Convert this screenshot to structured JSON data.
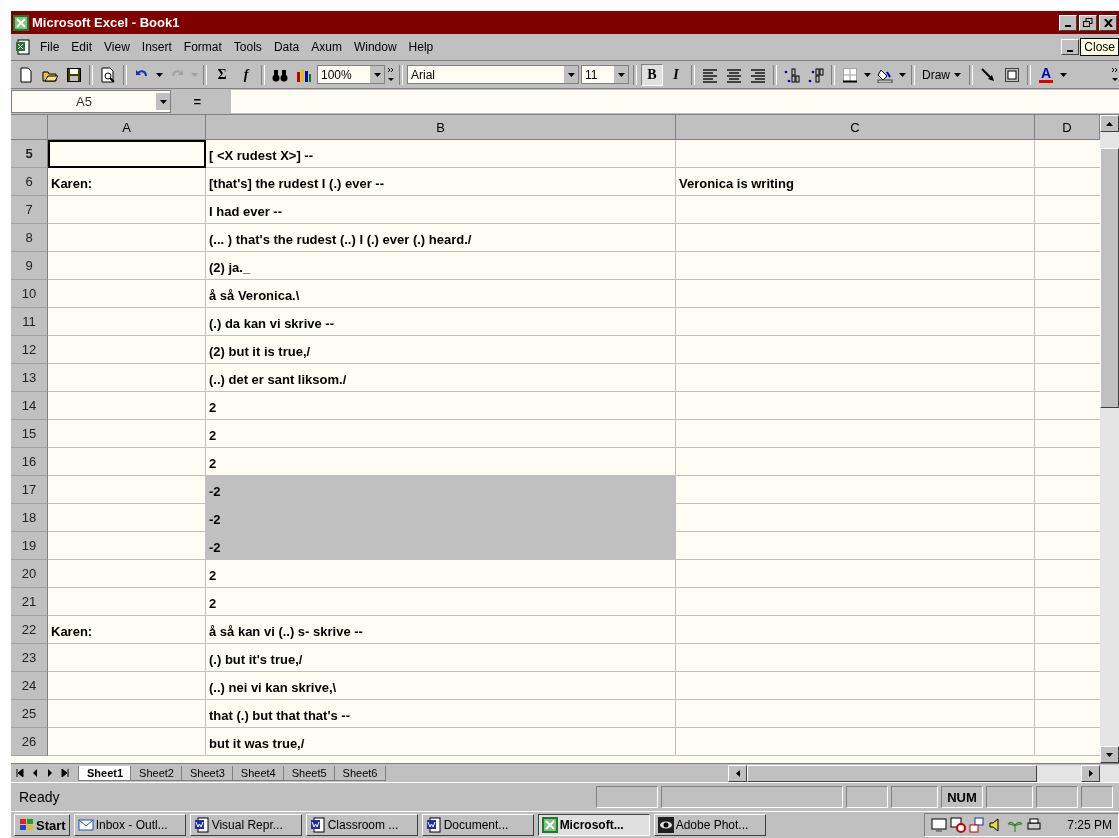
{
  "window": {
    "title": "Microsoft Excel - Book1",
    "tooltip": "Close"
  },
  "menu": [
    "File",
    "Edit",
    "View",
    "Insert",
    "Format",
    "Tools",
    "Data",
    "Axum",
    "Window",
    "Help"
  ],
  "toolbar": {
    "sum": "Σ",
    "function": "f",
    "zoom": "100%",
    "font": "Arial",
    "size": "11",
    "bold": {
      "label": "B",
      "on": true
    },
    "italic": {
      "label": "I",
      "on": false
    },
    "draw": "Draw",
    "font_color": "A"
  },
  "name_box": "A5",
  "formula_button": "=",
  "columns": [
    "A",
    "B",
    "C",
    "D"
  ],
  "rows": [
    {
      "header": "5",
      "selected": true,
      "cells": [
        {
          "active": true,
          "selected": false
        },
        {
          "text": "[ <X rudest X>] --",
          "active": false,
          "selected": false
        },
        {
          "active": false,
          "selected": false
        }
      ]
    },
    {
      "header": "6",
      "selected": false,
      "cells": [
        {
          "text": "Karen:",
          "active": false,
          "selected": false
        },
        {
          "text": "[that's] the rudest I (.) ever --",
          "active": false,
          "selected": false
        },
        {
          "text": "Veronica is writing",
          "active": false,
          "selected": false
        }
      ]
    },
    {
      "header": "7",
      "selected": false,
      "cells": [
        {
          "active": false,
          "selected": false
        },
        {
          "text": "I had ever --",
          "active": false,
          "selected": false
        },
        {
          "active": false,
          "selected": false
        }
      ]
    },
    {
      "header": "8",
      "selected": false,
      "cells": [
        {
          "active": false,
          "selected": false
        },
        {
          "text": "(... ) that's the rudest (..) I (.) ever (.) heard./",
          "active": false,
          "selected": false
        },
        {
          "active": false,
          "selected": false
        }
      ]
    },
    {
      "header": "9",
      "selected": false,
      "cells": [
        {
          "active": false,
          "selected": false
        },
        {
          "text": "(2) ja._",
          "active": false,
          "selected": false
        },
        {
          "active": false,
          "selected": false
        }
      ]
    },
    {
      "header": "10",
      "selected": false,
      "cells": [
        {
          "active": false,
          "selected": false
        },
        {
          "text": "å  så Veronica.\\",
          "active": false,
          "selected": false
        },
        {
          "active": false,
          "selected": false
        }
      ]
    },
    {
      "header": "11",
      "selected": false,
      "cells": [
        {
          "active": false,
          "selected": false
        },
        {
          "text": "(.) da kan vi skrive --",
          "active": false,
          "selected": false
        },
        {
          "active": false,
          "selected": false
        }
      ]
    },
    {
      "header": "12",
      "selected": false,
      "cells": [
        {
          "active": false,
          "selected": false
        },
        {
          "text": "(2) but it is true,/",
          "active": false,
          "selected": false
        },
        {
          "active": false,
          "selected": false
        }
      ]
    },
    {
      "header": "13",
      "selected": false,
      "cells": [
        {
          "active": false,
          "selected": false
        },
        {
          "text": "(..) det er sant liksom./",
          "active": false,
          "selected": false
        },
        {
          "active": false,
          "selected": false
        }
      ]
    },
    {
      "header": "14",
      "selected": false,
      "cells": [
        {
          "active": false,
          "selected": false
        },
        {
          "text": "2",
          "active": false,
          "selected": false
        },
        {
          "active": false,
          "selected": false
        }
      ]
    },
    {
      "header": "15",
      "selected": false,
      "cells": [
        {
          "active": false,
          "selected": false
        },
        {
          "text": "2",
          "active": false,
          "selected": false
        },
        {
          "active": false,
          "selected": false
        }
      ]
    },
    {
      "header": "16",
      "selected": false,
      "cells": [
        {
          "active": false,
          "selected": false
        },
        {
          "text": "2",
          "active": false,
          "selected": false
        },
        {
          "active": false,
          "selected": false
        }
      ]
    },
    {
      "header": "17",
      "selected": false,
      "cells": [
        {
          "active": false,
          "selected": false
        },
        {
          "text": "-2",
          "active": false,
          "selected": true
        },
        {
          "active": false,
          "selected": false
        }
      ]
    },
    {
      "header": "18",
      "selected": false,
      "cells": [
        {
          "active": false,
          "selected": false
        },
        {
          "text": "-2",
          "active": false,
          "selected": true
        },
        {
          "active": false,
          "selected": false
        }
      ]
    },
    {
      "header": "19",
      "selected": false,
      "cells": [
        {
          "active": false,
          "selected": false
        },
        {
          "text": "-2",
          "active": false,
          "selected": true
        },
        {
          "active": false,
          "selected": false
        }
      ]
    },
    {
      "header": "20",
      "selected": false,
      "cells": [
        {
          "active": false,
          "selected": false
        },
        {
          "text": "2",
          "active": false,
          "selected": false
        },
        {
          "active": false,
          "selected": false
        }
      ]
    },
    {
      "header": "21",
      "selected": false,
      "cells": [
        {
          "active": false,
          "selected": false
        },
        {
          "text": "2",
          "active": false,
          "selected": false
        },
        {
          "active": false,
          "selected": false
        }
      ]
    },
    {
      "header": "22",
      "selected": false,
      "cells": [
        {
          "text": "Karen:",
          "active": false,
          "selected": false
        },
        {
          "text": "å så kan vi (..) s- skrive --",
          "active": false,
          "selected": false
        },
        {
          "active": false,
          "selected": false
        }
      ]
    },
    {
      "header": "23",
      "selected": false,
      "cells": [
        {
          "active": false,
          "selected": false
        },
        {
          "text": "(.) but it's true,/",
          "active": false,
          "selected": false
        },
        {
          "active": false,
          "selected": false
        }
      ]
    },
    {
      "header": "24",
      "selected": false,
      "cells": [
        {
          "active": false,
          "selected": false
        },
        {
          "text": "(..) nei vi kan skrive,\\",
          "active": false,
          "selected": false
        },
        {
          "active": false,
          "selected": false
        }
      ]
    },
    {
      "header": "25",
      "selected": false,
      "cells": [
        {
          "active": false,
          "selected": false
        },
        {
          "text": "that (.) but that that's --",
          "active": false,
          "selected": false
        },
        {
          "active": false,
          "selected": false
        }
      ]
    },
    {
      "header": "26",
      "selected": false,
      "cells": [
        {
          "active": false,
          "selected": false
        },
        {
          "text": "but it was true,/",
          "active": false,
          "selected": false
        },
        {
          "active": false,
          "selected": false
        }
      ]
    }
  ],
  "sheet_tabs": [
    {
      "label": "Sheet1",
      "selected": true
    },
    {
      "label": "Sheet2",
      "selected": false
    },
    {
      "label": "Sheet3",
      "selected": false
    },
    {
      "label": "Sheet4",
      "selected": false
    },
    {
      "label": "Sheet5",
      "selected": false
    },
    {
      "label": "Sheet6",
      "selected": false
    }
  ],
  "status_bar": {
    "text": "Ready",
    "indicator": "NUM"
  },
  "taskbar": {
    "start": "Start",
    "tasks": [
      {
        "label": "Inbox - Outl...",
        "kind": "mail",
        "selected": false
      },
      {
        "label": "Visual Repr...",
        "kind": "doc",
        "selected": false
      },
      {
        "label": "Classroom ...",
        "kind": "doc",
        "selected": false
      },
      {
        "label": "Document...",
        "kind": "doc",
        "selected": false
      },
      {
        "label": "Microsoft...",
        "kind": "sheet",
        "selected": true
      },
      {
        "label": "Adobe Phot...",
        "kind": "photo",
        "selected": false
      }
    ],
    "clock": "7:25 PM"
  }
}
